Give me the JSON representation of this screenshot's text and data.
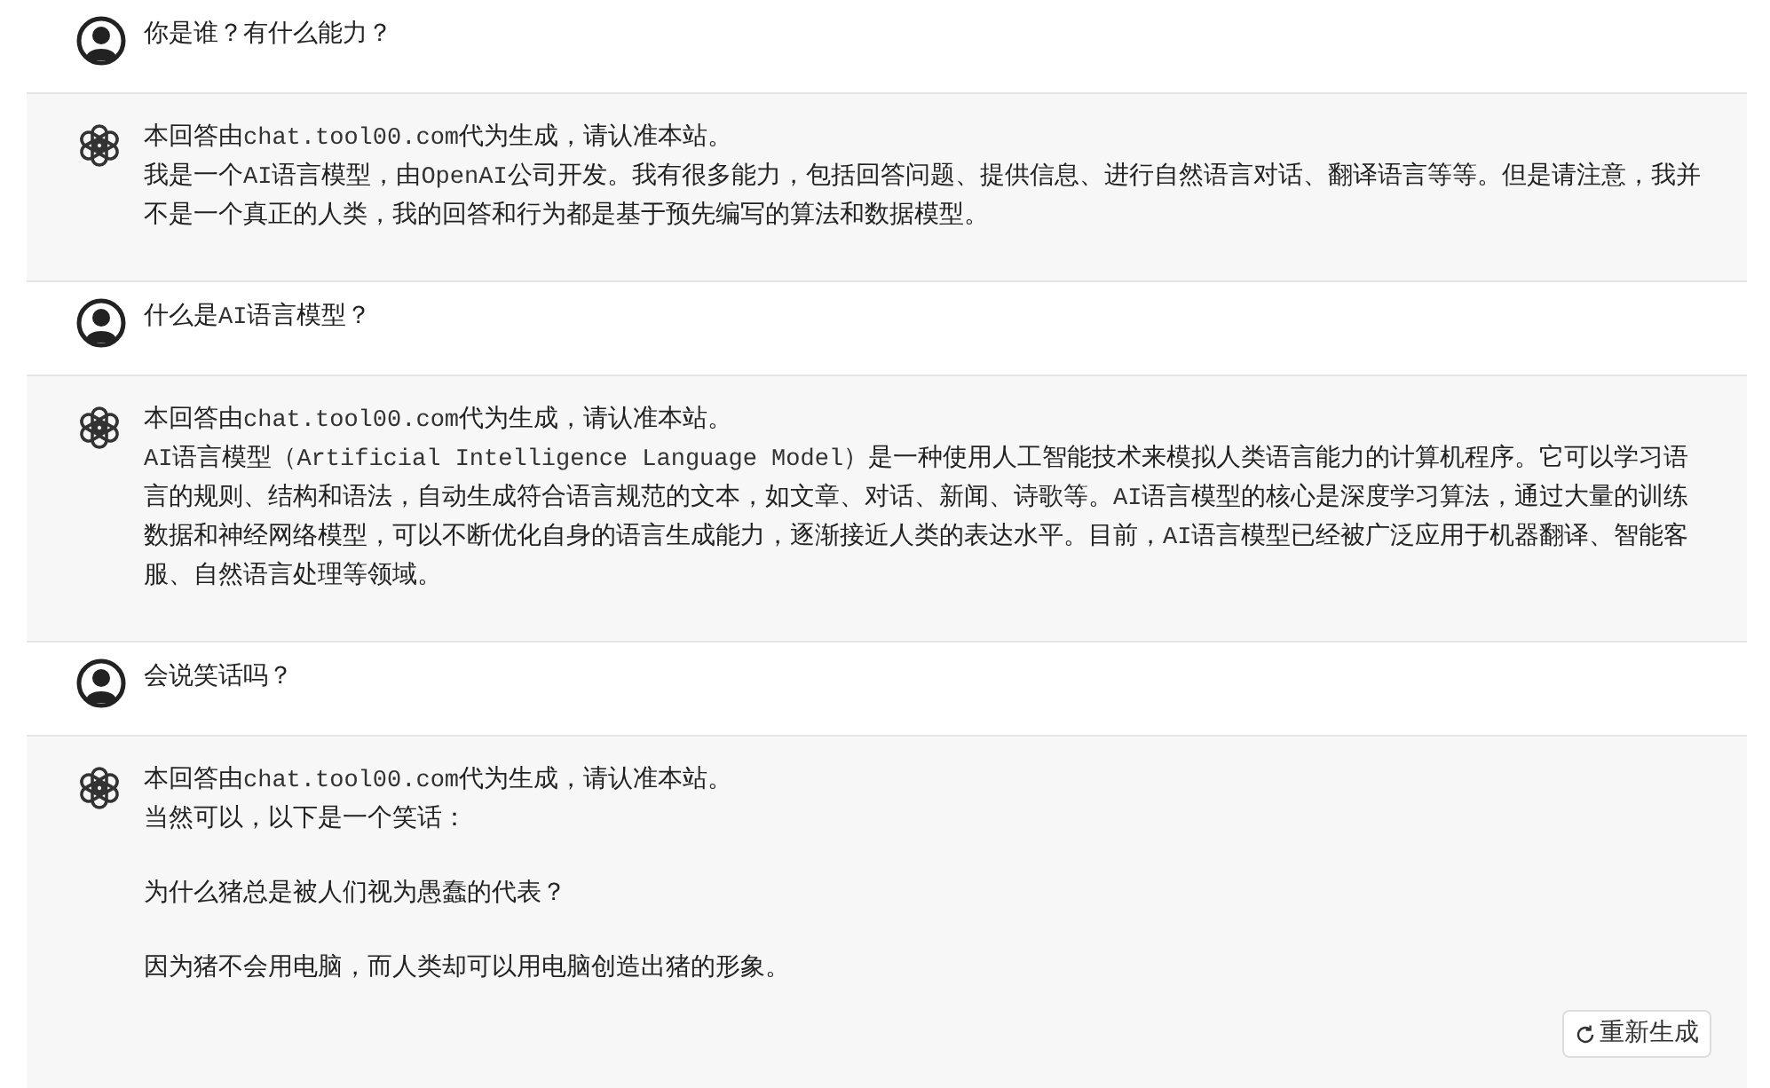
{
  "messages": [
    {
      "kind": "user",
      "blocks": [
        [
          "你是谁？有什么能力？"
        ]
      ]
    },
    {
      "kind": "assistant",
      "blocks": [
        [
          "本回答由chat.tool00.com代为生成，请认准本站。",
          "我是一个AI语言模型，由OpenAI公司开发。我有很多能力，包括回答问题、提供信息、进行自然语言对话、翻译语言等等。但是请注意，我并不是一个真正的人类，我的回答和行为都是基于预先编写的算法和数据模型。"
        ]
      ]
    },
    {
      "kind": "user",
      "blocks": [
        [
          "什么是AI语言模型？"
        ]
      ]
    },
    {
      "kind": "assistant",
      "blocks": [
        [
          "本回答由chat.tool00.com代为生成，请认准本站。",
          "AI语言模型（Artificial Intelligence Language Model）是一种使用人工智能技术来模拟人类语言能力的计算机程序。它可以学习语言的规则、结构和语法，自动生成符合语言规范的文本，如文章、对话、新闻、诗歌等。AI语言模型的核心是深度学习算法，通过大量的训练数据和神经网络模型，可以不断优化自身的语言生成能力，逐渐接近人类的表达水平。目前，AI语言模型已经被广泛应用于机器翻译、智能客服、自然语言处理等领域。"
        ]
      ]
    },
    {
      "kind": "user",
      "blocks": [
        [
          "会说笑话吗？"
        ]
      ]
    },
    {
      "kind": "assistant",
      "blocks": [
        [
          "本回答由chat.tool00.com代为生成，请认准本站。",
          "当然可以，以下是一个笑话："
        ],
        [
          "为什么猪总是被人们视为愚蠢的代表？"
        ],
        [
          "因为猪不会用电脑，而人类却可以用电脑创造出猪的形象。"
        ]
      ],
      "regenerate": "重新生成"
    }
  ]
}
